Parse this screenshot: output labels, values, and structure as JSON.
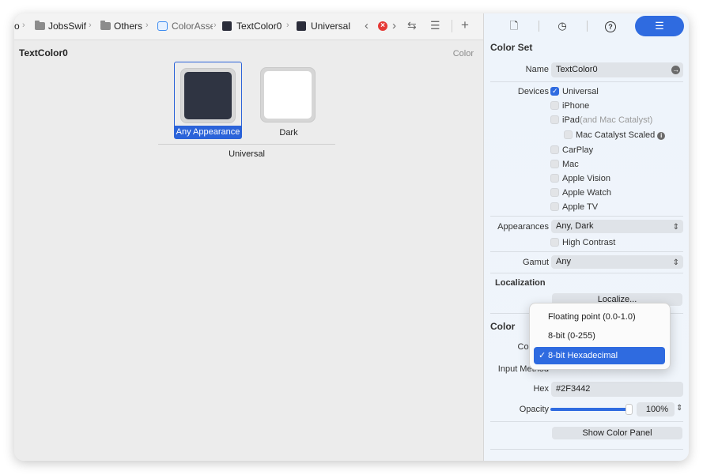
{
  "breadcrumbs": [
    {
      "label": "o",
      "icon": "none"
    },
    {
      "label": "JobsSwif",
      "icon": "folder-icon"
    },
    {
      "label": "Others",
      "icon": "folder-icon"
    },
    {
      "label": "ColorAsse",
      "icon": "asset-catalog-icon"
    },
    {
      "label": "TextColor0",
      "icon": "color-swatch-icon"
    },
    {
      "label": "Universal",
      "icon": "color-swatch-icon"
    }
  ],
  "toolbar": {
    "back_icon": "chevron-left-icon",
    "forward_icon": "chevron-right-icon",
    "error_icon": "error-icon",
    "swap_icon": "swap-arrows-icon",
    "menu_icon": "lines-icon",
    "add_icon": "plus-icon"
  },
  "editor": {
    "title": "TextColor0",
    "subtitle": "Color",
    "slots": [
      {
        "label": "Any Appearance",
        "color": "#2F3442",
        "selected": true
      },
      {
        "label": "Dark",
        "color": "#FFFFFF",
        "selected": false
      }
    ],
    "group_label": "Universal"
  },
  "inspector": {
    "tabs": [
      {
        "name": "file-icon",
        "glyph": "🗋",
        "active": false
      },
      {
        "name": "history-icon",
        "glyph": "◷",
        "active": false
      },
      {
        "name": "help-icon",
        "glyph": "?",
        "active": false
      },
      {
        "name": "attributes-icon",
        "glyph": "☰",
        "active": true
      }
    ],
    "color_set": {
      "heading": "Color Set",
      "name_label": "Name",
      "name_value": "TextColor0",
      "devices_label": "Devices",
      "devices": [
        {
          "label": "Universal",
          "checked": true
        },
        {
          "label": "iPhone",
          "checked": false
        },
        {
          "label": "iPad",
          "note": "(and Mac Catalyst)",
          "checked": false
        },
        {
          "label": "Mac Catalyst Scaled",
          "checked": false
        },
        {
          "label": "CarPlay",
          "checked": false
        },
        {
          "label": "Mac",
          "checked": false
        },
        {
          "label": "Apple Vision",
          "checked": false
        },
        {
          "label": "Apple Watch",
          "checked": false
        },
        {
          "label": "Apple TV",
          "checked": false
        }
      ],
      "appearances_label": "Appearances",
      "appearances_value": "Any, Dark",
      "high_contrast_label": "High Contrast",
      "gamut_label": "Gamut",
      "gamut_value": "Any"
    },
    "localization": {
      "heading": "Localization",
      "button": "Localize..."
    },
    "color": {
      "heading": "Color",
      "content_label": "Conten",
      "input_method_label": "Input Method",
      "hex_label": "Hex",
      "hex_value": "#2F3442",
      "opacity_label": "Opacity",
      "opacity_value": "100%",
      "opacity_fraction": 1.0,
      "show_panel_button": "Show Color Panel"
    }
  },
  "input_method_menu": {
    "options": [
      {
        "label": "Floating point (0.0-1.0)",
        "selected": false
      },
      {
        "label": "8-bit (0-255)",
        "selected": false
      },
      {
        "label": "8-bit Hexadecimal",
        "selected": true
      }
    ],
    "check_glyph": "✓"
  },
  "colors": {
    "accent": "#2F6BE0",
    "selection": "#2B63D9"
  }
}
